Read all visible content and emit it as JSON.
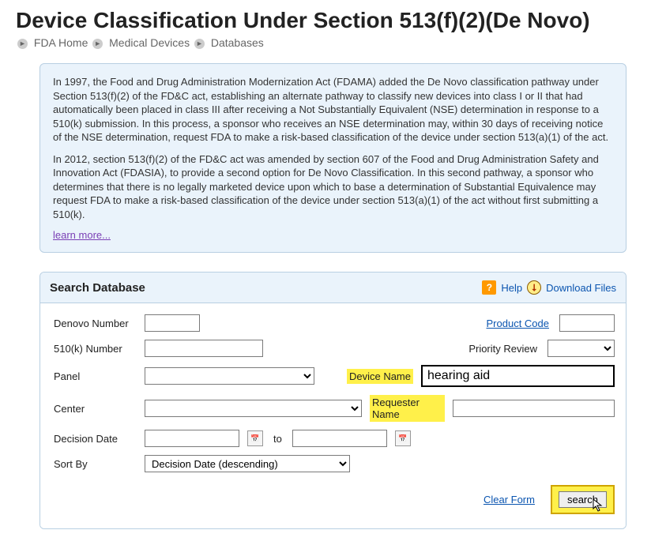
{
  "page": {
    "title": "Device Classification Under Section 513(f)(2)(De Novo)"
  },
  "breadcrumbs": {
    "items": [
      "FDA Home",
      "Medical Devices",
      "Databases"
    ]
  },
  "info": {
    "p1": "In 1997, the Food and Drug Administration Modernization Act (FDAMA) added the De Novo classification pathway under Section 513(f)(2) of the FD&C act, establishing an alternate pathway to classify new devices into class I or II that had automatically been placed in class III after receiving a Not Substantially Equivalent (NSE) determination in response to a 510(k) submission. In this process, a sponsor who receives an NSE determination may, within 30 days of receiving notice of the NSE determination, request FDA to make a risk-based classification of the device under section 513(a)(1) of the act.",
    "p2": "In 2012, section 513(f)(2) of the FD&C act was amended by section 607 of the Food and Drug Administration Safety and Innovation Act (FDASIA), to provide a second option for De Novo Classification. In this second pathway, a sponsor who determines that there is no legally marketed device upon which to base a determination of Substantial Equivalence may request FDA to make a risk-based classification of the device under section 513(a)(1) of the act without first submitting a 510(k).",
    "learn_more": "learn more..."
  },
  "search": {
    "header_title": "Search Database",
    "help_label": "Help",
    "download_label": "Download Files",
    "labels": {
      "denovo_number": "Denovo Number",
      "k510_number": "510(k) Number",
      "panel": "Panel",
      "center": "Center",
      "decision_date": "Decision Date",
      "date_to": "to",
      "sort_by": "Sort By",
      "product_code": "Product Code",
      "priority_review": "Priority Review",
      "device_name": "Device Name",
      "requester_name": "Requester Name"
    },
    "values": {
      "denovo_number": "",
      "k510_number": "",
      "panel": "",
      "center": "",
      "decision_date_from": "",
      "decision_date_to": "",
      "sort_by": "Decision Date (descending)",
      "product_code": "",
      "priority_review": "",
      "device_name": "hearing aid",
      "requester_name": ""
    },
    "actions": {
      "clear_form": "Clear Form",
      "search": "search"
    }
  }
}
